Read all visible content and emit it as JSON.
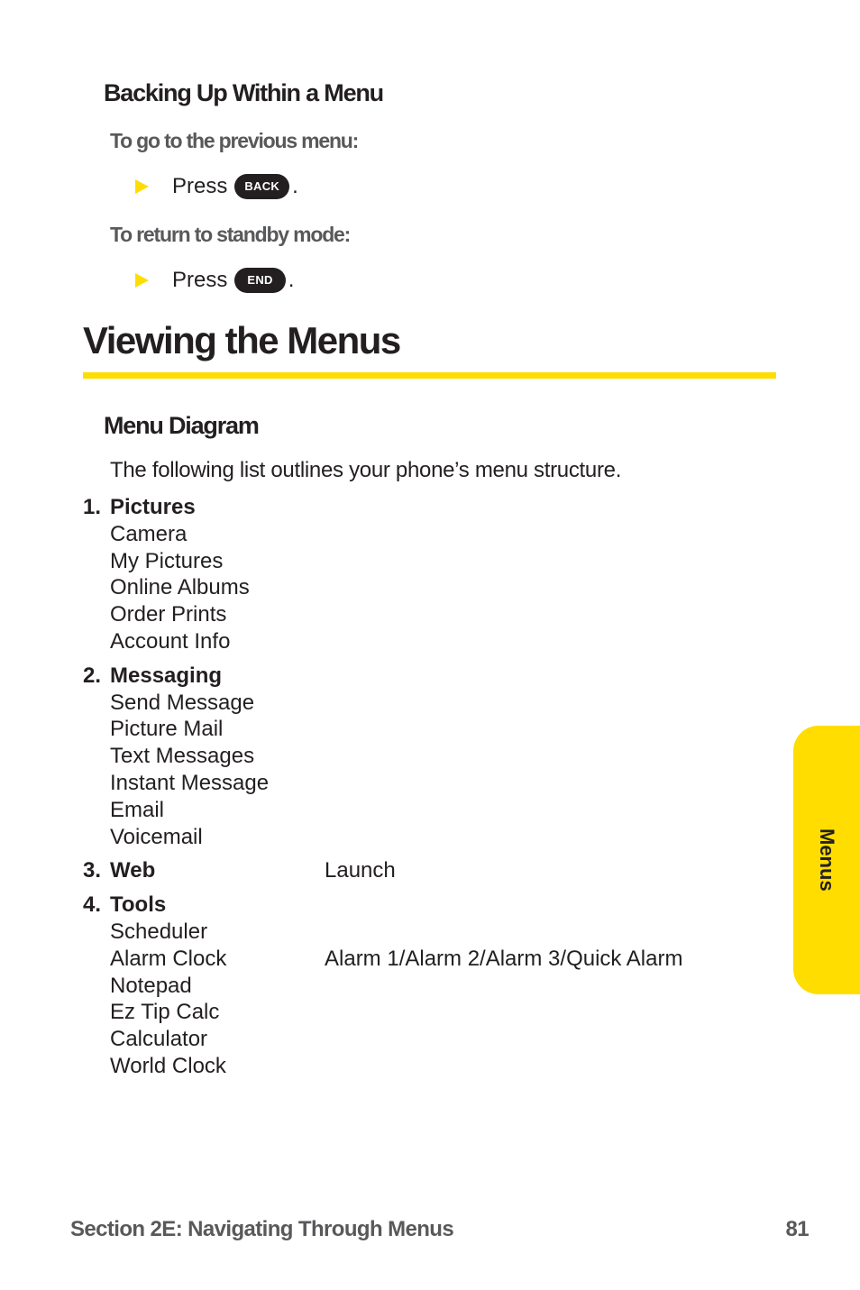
{
  "backing_up": {
    "heading": "Backing Up Within a Menu",
    "previous_menu": {
      "label": "To go to the previous menu:",
      "press": "Press",
      "key": "BACK",
      "end": "."
    },
    "standby": {
      "label": "To return to standby mode:",
      "press": "Press",
      "key": "END",
      "end": "."
    }
  },
  "section": {
    "title": "Viewing the Menus",
    "rule_color": "#ffdd00"
  },
  "menu_diagram": {
    "heading": "Menu Diagram",
    "intro": "The following list outlines your phone’s menu structure.",
    "categories": [
      {
        "num": "1.",
        "label": "Pictures",
        "detail": "",
        "items": [
          {
            "label": "Camera",
            "detail": ""
          },
          {
            "label": "My Pictures",
            "detail": ""
          },
          {
            "label": "Online Albums",
            "detail": ""
          },
          {
            "label": "Order Prints",
            "detail": ""
          },
          {
            "label": "Account Info",
            "detail": ""
          }
        ]
      },
      {
        "num": "2.",
        "label": "Messaging",
        "detail": "",
        "items": [
          {
            "label": "Send Message",
            "detail": ""
          },
          {
            "label": "Picture Mail",
            "detail": ""
          },
          {
            "label": "Text Messages",
            "detail": ""
          },
          {
            "label": "Instant Message",
            "detail": ""
          },
          {
            "label": "Email",
            "detail": ""
          },
          {
            "label": "Voicemail",
            "detail": ""
          }
        ]
      },
      {
        "num": "3.",
        "label": "Web",
        "detail": "Launch",
        "items": []
      },
      {
        "num": "4.",
        "label": "Tools",
        "detail": "",
        "items": [
          {
            "label": "Scheduler",
            "detail": ""
          },
          {
            "label": "Alarm Clock",
            "detail": "Alarm 1/Alarm 2/Alarm 3/Quick Alarm"
          },
          {
            "label": "Notepad",
            "detail": ""
          },
          {
            "label": "Ez Tip Calc",
            "detail": ""
          },
          {
            "label": "Calculator",
            "detail": ""
          },
          {
            "label": "World Clock",
            "detail": ""
          }
        ]
      }
    ]
  },
  "side_tab": {
    "label": "Menus",
    "color": "#ffdd00"
  },
  "footer": {
    "section": "Section 2E: Navigating Through Menus",
    "page": "81"
  }
}
